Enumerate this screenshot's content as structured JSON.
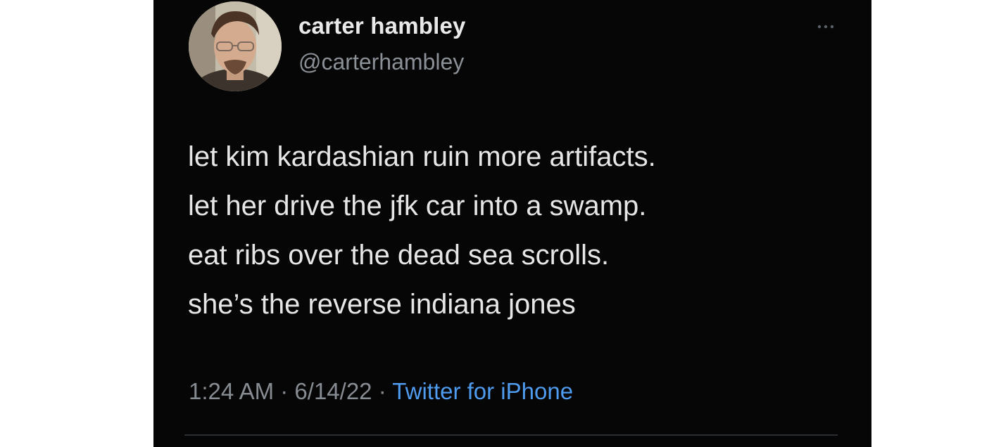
{
  "tweet": {
    "author": {
      "display_name": "carter hambley",
      "handle": "@carterhambley"
    },
    "text_lines": [
      "let kim kardashian ruin more artifacts.",
      "let her drive the jfk car into a swamp.",
      "eat ribs over the dead sea scrolls.",
      "she’s the reverse indiana jones"
    ],
    "time": "1:24 AM",
    "date": "6/14/22",
    "source": "Twitter for iPhone",
    "separator": "·"
  },
  "icons": {
    "more": "more-horizontal-icon",
    "avatar": "profile-photo"
  },
  "colors": {
    "background": "#060606",
    "text": "#e6e6e6",
    "secondary_text": "#878c93",
    "link": "#4f9bef"
  }
}
